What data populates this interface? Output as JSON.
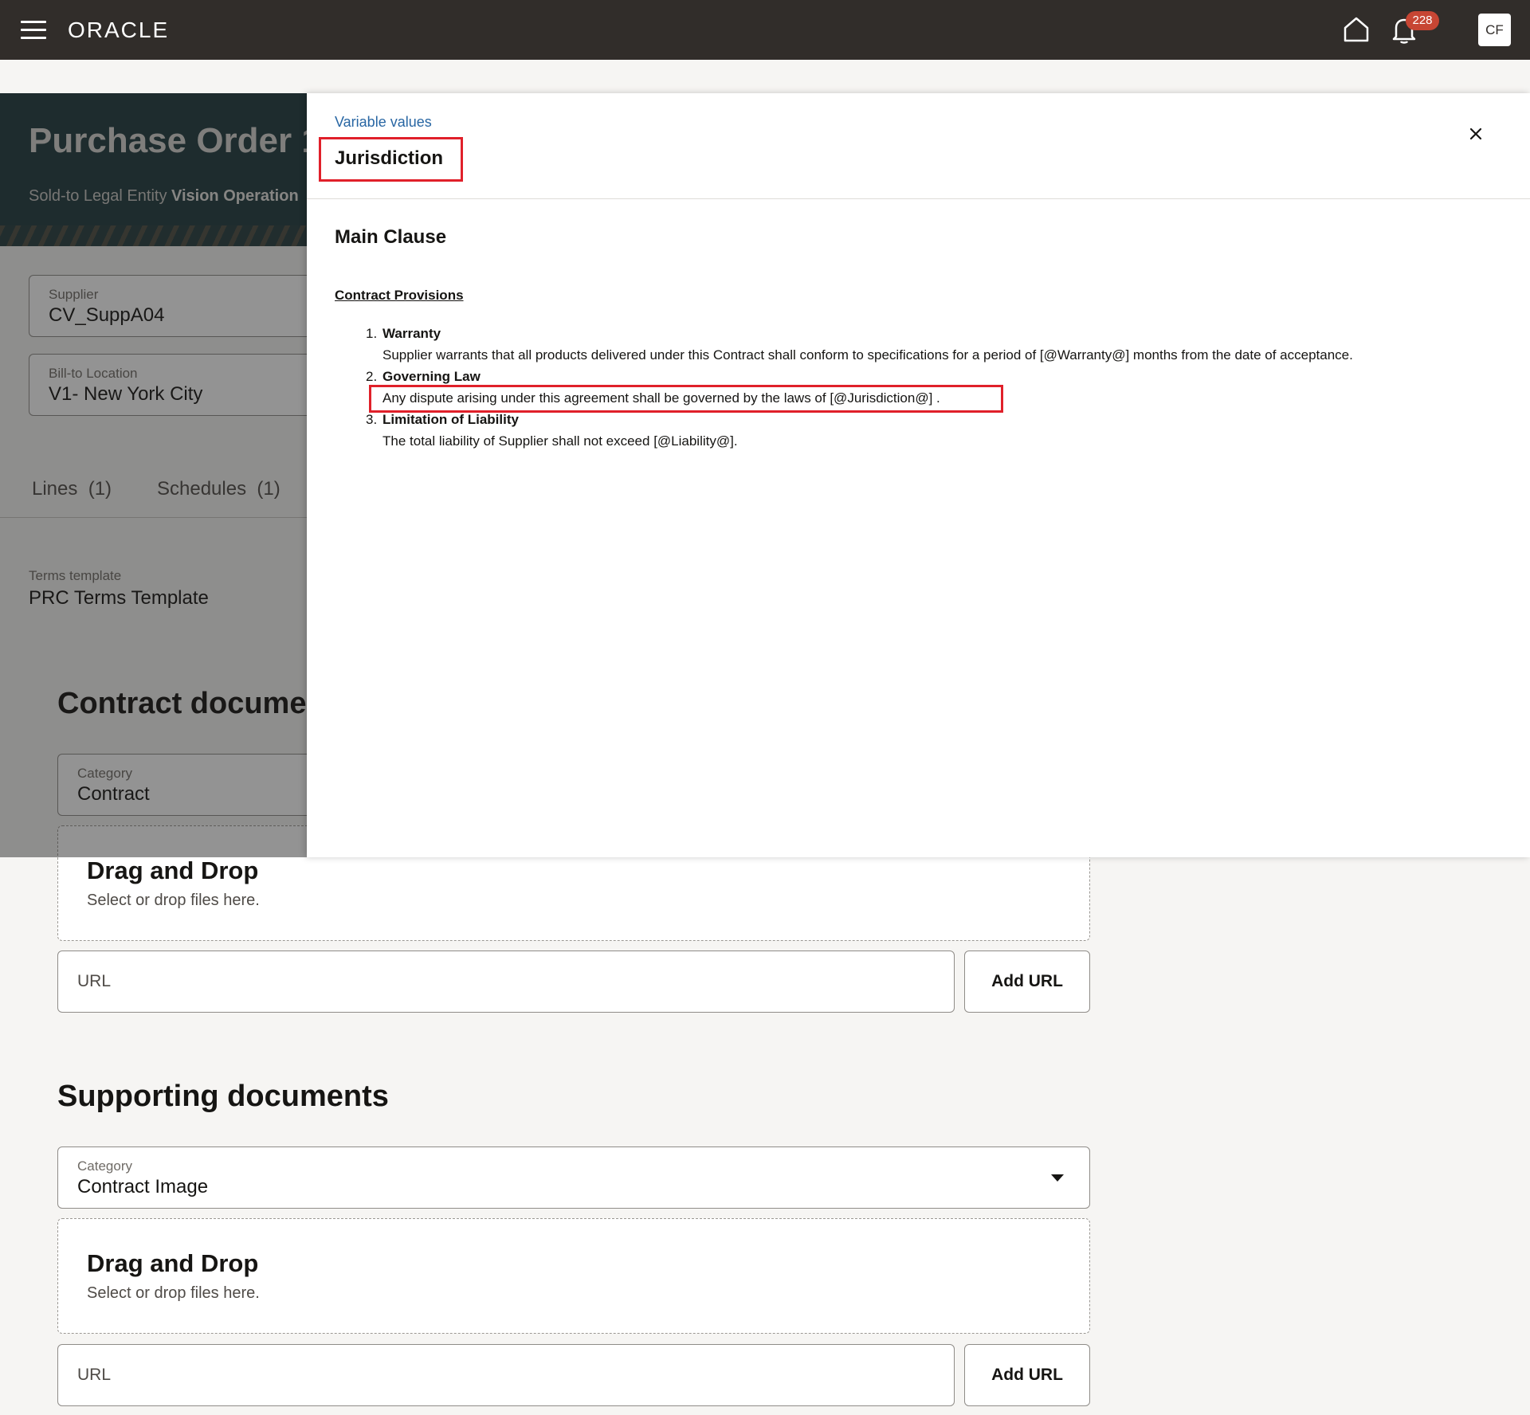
{
  "topbar": {
    "brand": "ORACLE",
    "notification_count": "228",
    "user_initials": "CF"
  },
  "page": {
    "title": "Purchase Order 1",
    "sold_to_label": "Sold-to Legal Entity",
    "sold_to_value": "Vision Operation",
    "supplier_label": "Supplier",
    "supplier_value": "CV_SuppA04",
    "bill_to_label": "Bill-to Location",
    "bill_to_value": "V1- New York City",
    "tabs": [
      {
        "label": "Lines",
        "count": "(1)"
      },
      {
        "label": "Schedules",
        "count": "(1)"
      }
    ],
    "terms_label": "Terms template",
    "terms_value": "PRC Terms Template",
    "contract_docs": {
      "title": "Contract documer",
      "category_label": "Category",
      "category_value": "Contract",
      "drag_title": "Drag and Drop",
      "drag_sub": "Select or drop files here.",
      "url_placeholder": "URL",
      "add_url": "Add URL"
    },
    "supporting_docs": {
      "title": "Supporting documents",
      "category_label": "Category",
      "category_value": "Contract Image",
      "drag_title": "Drag and Drop",
      "drag_sub": "Select or drop files here.",
      "url_placeholder": "URL",
      "add_url": "Add URL"
    }
  },
  "drawer": {
    "breadcrumb": "Variable values",
    "title": "Jurisdiction",
    "clause_title": "Main Clause",
    "provisions_heading": "Contract Provisions",
    "items": [
      {
        "num": "1.",
        "heading": "Warranty",
        "text": "Supplier warrants that all products delivered under this Contract shall conform to specifications for a period of [@Warranty@] months from the date of acceptance."
      },
      {
        "num": "2.",
        "heading": "Governing Law",
        "text": "Any dispute arising under this agreement shall be governed by the laws of [@Jurisdiction@] ."
      },
      {
        "num": "3.",
        "heading": "Limitation of Liability",
        "text": "The total liability of Supplier shall not exceed [@Liability@]."
      }
    ]
  },
  "colors": {
    "topbar": "#312d2a",
    "highlight": "#e0202a",
    "link": "#2866a3",
    "badge": "#c74634"
  }
}
